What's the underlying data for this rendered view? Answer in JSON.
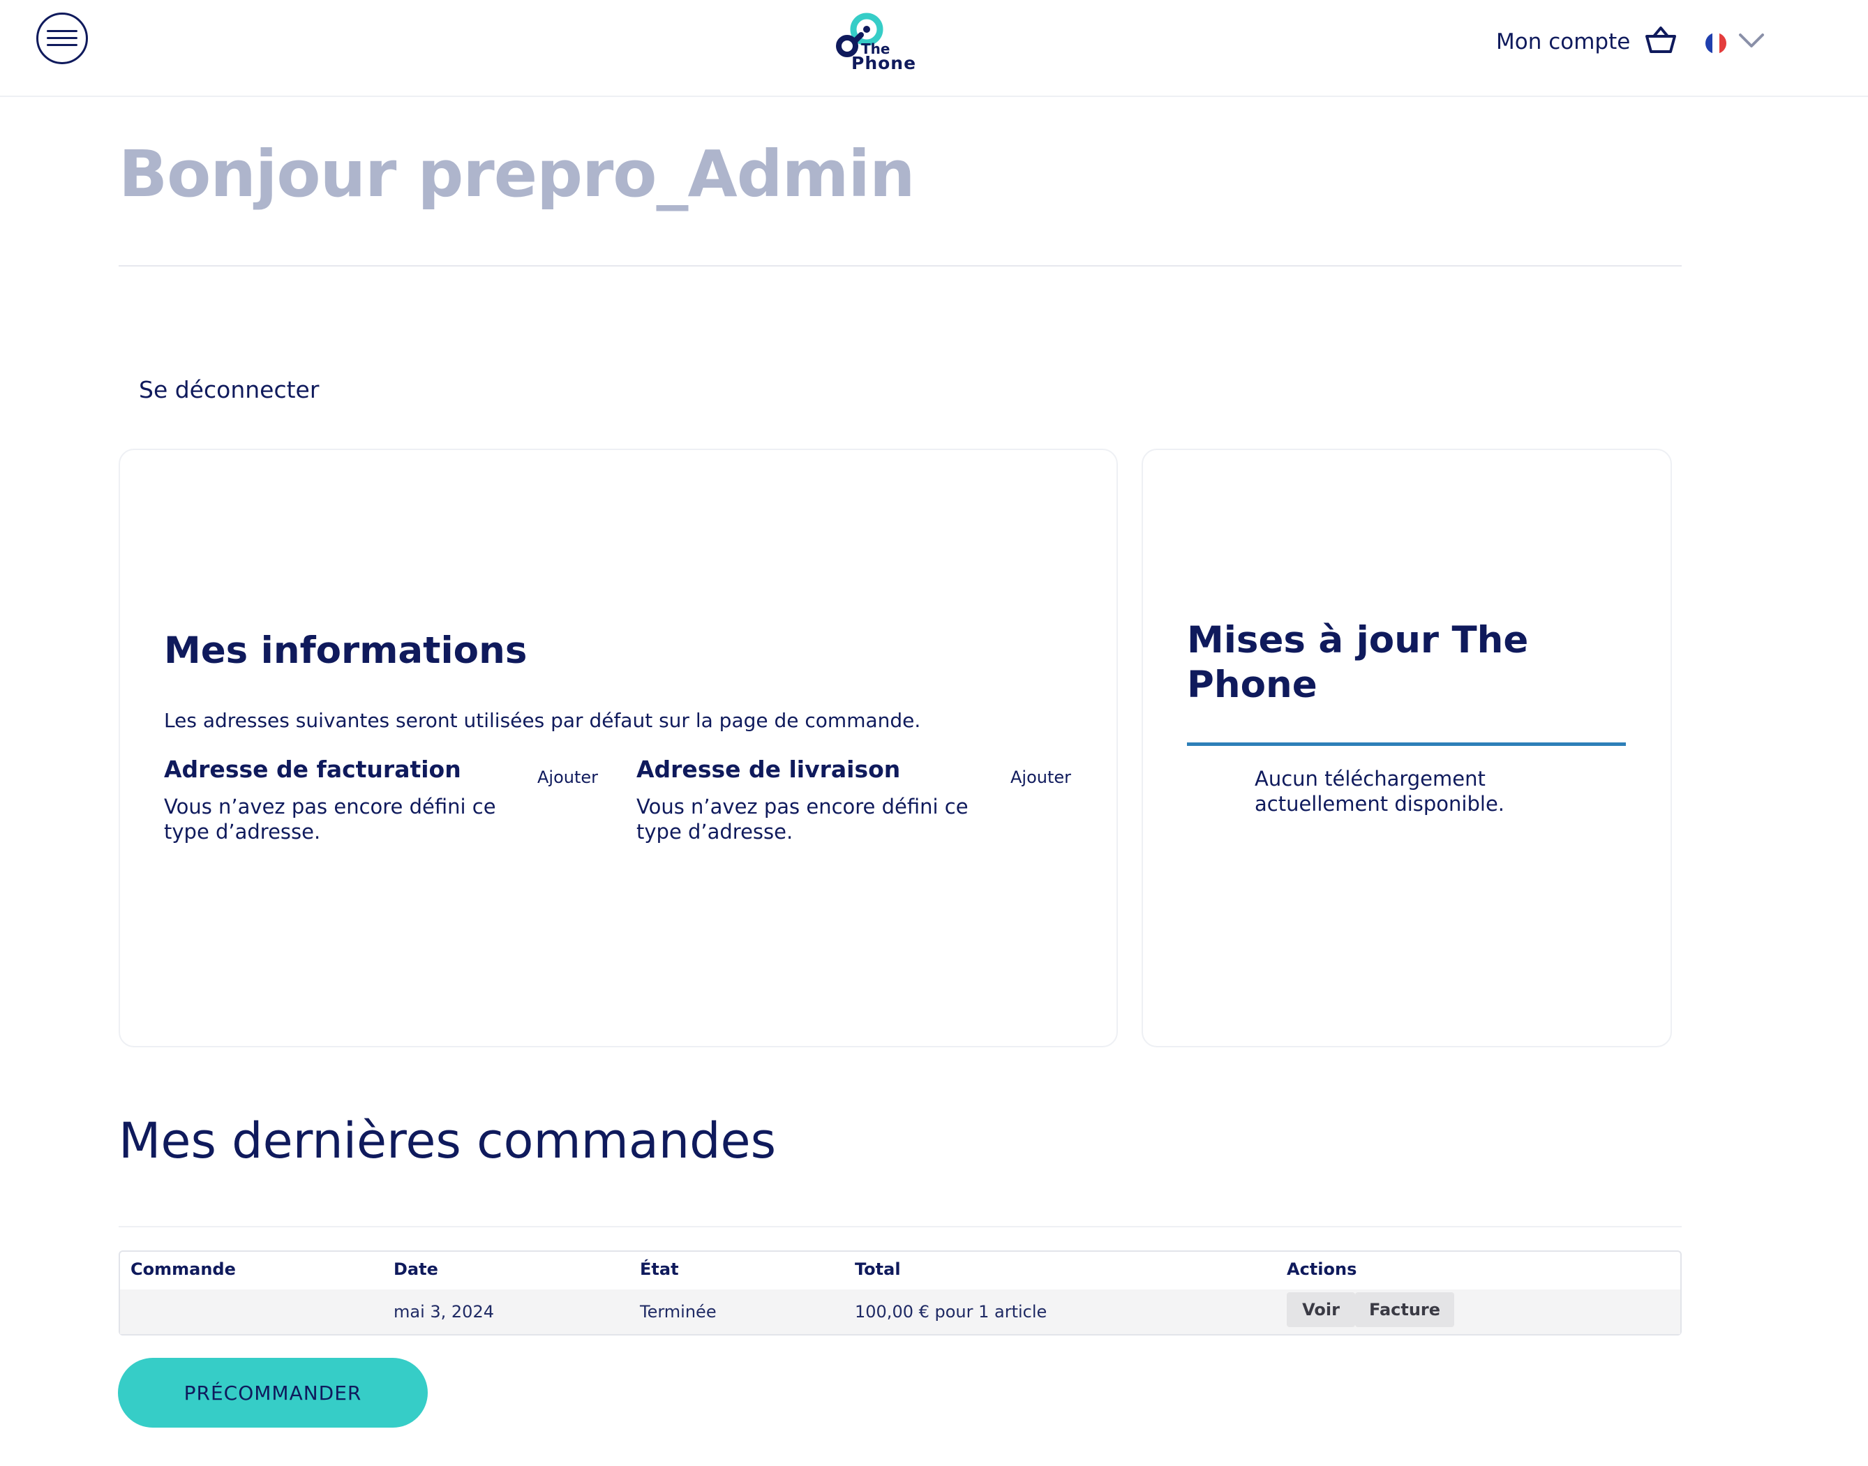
{
  "header": {
    "logo_the": "The",
    "logo_phone": "Phone",
    "account_label": "Mon compte",
    "colors": {
      "brand_teal": "#36cdc7",
      "brand_navy": "#0f1a5c",
      "flag_blue": "#1f3fae",
      "flag_red": "#e43d3d"
    }
  },
  "greeting": "Bonjour prepro_Admin",
  "logout_label": "Se déconnecter",
  "info_card": {
    "title": "Mes informations",
    "description": "Les adresses suivantes seront utilisées par défaut sur la page de commande.",
    "billing": {
      "title": "Adresse de facturation",
      "action": "Ajouter",
      "empty": "Vous n’avez pas encore défini ce type d’adresse."
    },
    "shipping": {
      "title": "Adresse de livraison",
      "action": "Ajouter",
      "empty": "Vous n’avez pas encore défini ce type d’adresse."
    }
  },
  "updates_card": {
    "title": "Mises à jour The Phone",
    "empty": "Aucun téléchargement actuellement disponible."
  },
  "orders": {
    "title": "Mes dernières commandes",
    "columns": [
      "Commande",
      "Date",
      "État",
      "Total",
      "Actions"
    ],
    "rows": [
      {
        "order": "",
        "date": "mai 3, 2024",
        "status": "Terminée",
        "total": "100,00 € pour 1 article",
        "actions": [
          "Voir",
          "Facture"
        ]
      }
    ]
  },
  "cta_label": "PRÉCOMMANDER"
}
